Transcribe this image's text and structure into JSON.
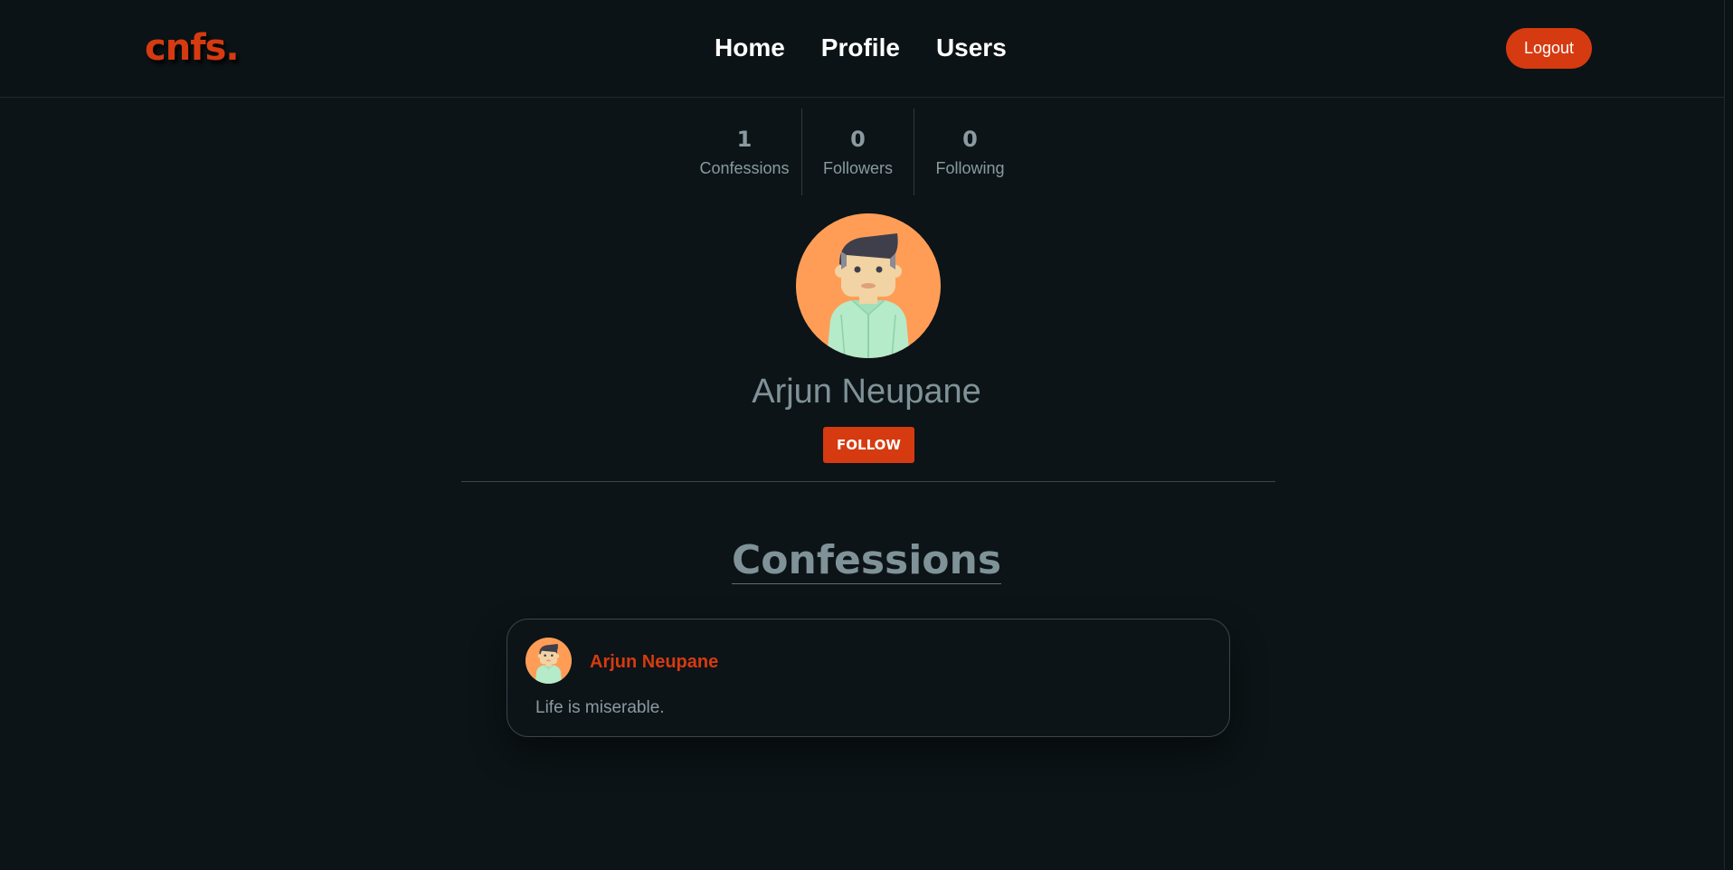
{
  "navbar": {
    "logo": "cnfs.",
    "links": [
      "Home",
      "Profile",
      "Users"
    ],
    "logout_label": "Logout"
  },
  "stats": [
    {
      "value": "1",
      "label": "Confessions"
    },
    {
      "value": "0",
      "label": "Followers"
    },
    {
      "value": "0",
      "label": "Following"
    }
  ],
  "profile": {
    "name": "Arjun Neupane",
    "follow_label": "FOLLOW"
  },
  "confessions": {
    "title": "Confessions",
    "items": [
      {
        "author": "Arjun Neupane",
        "text": "Life is miserable."
      }
    ]
  },
  "colors": {
    "accent": "#d63a10",
    "background": "#0c1417",
    "avatar_bg": "#ff9d57"
  }
}
